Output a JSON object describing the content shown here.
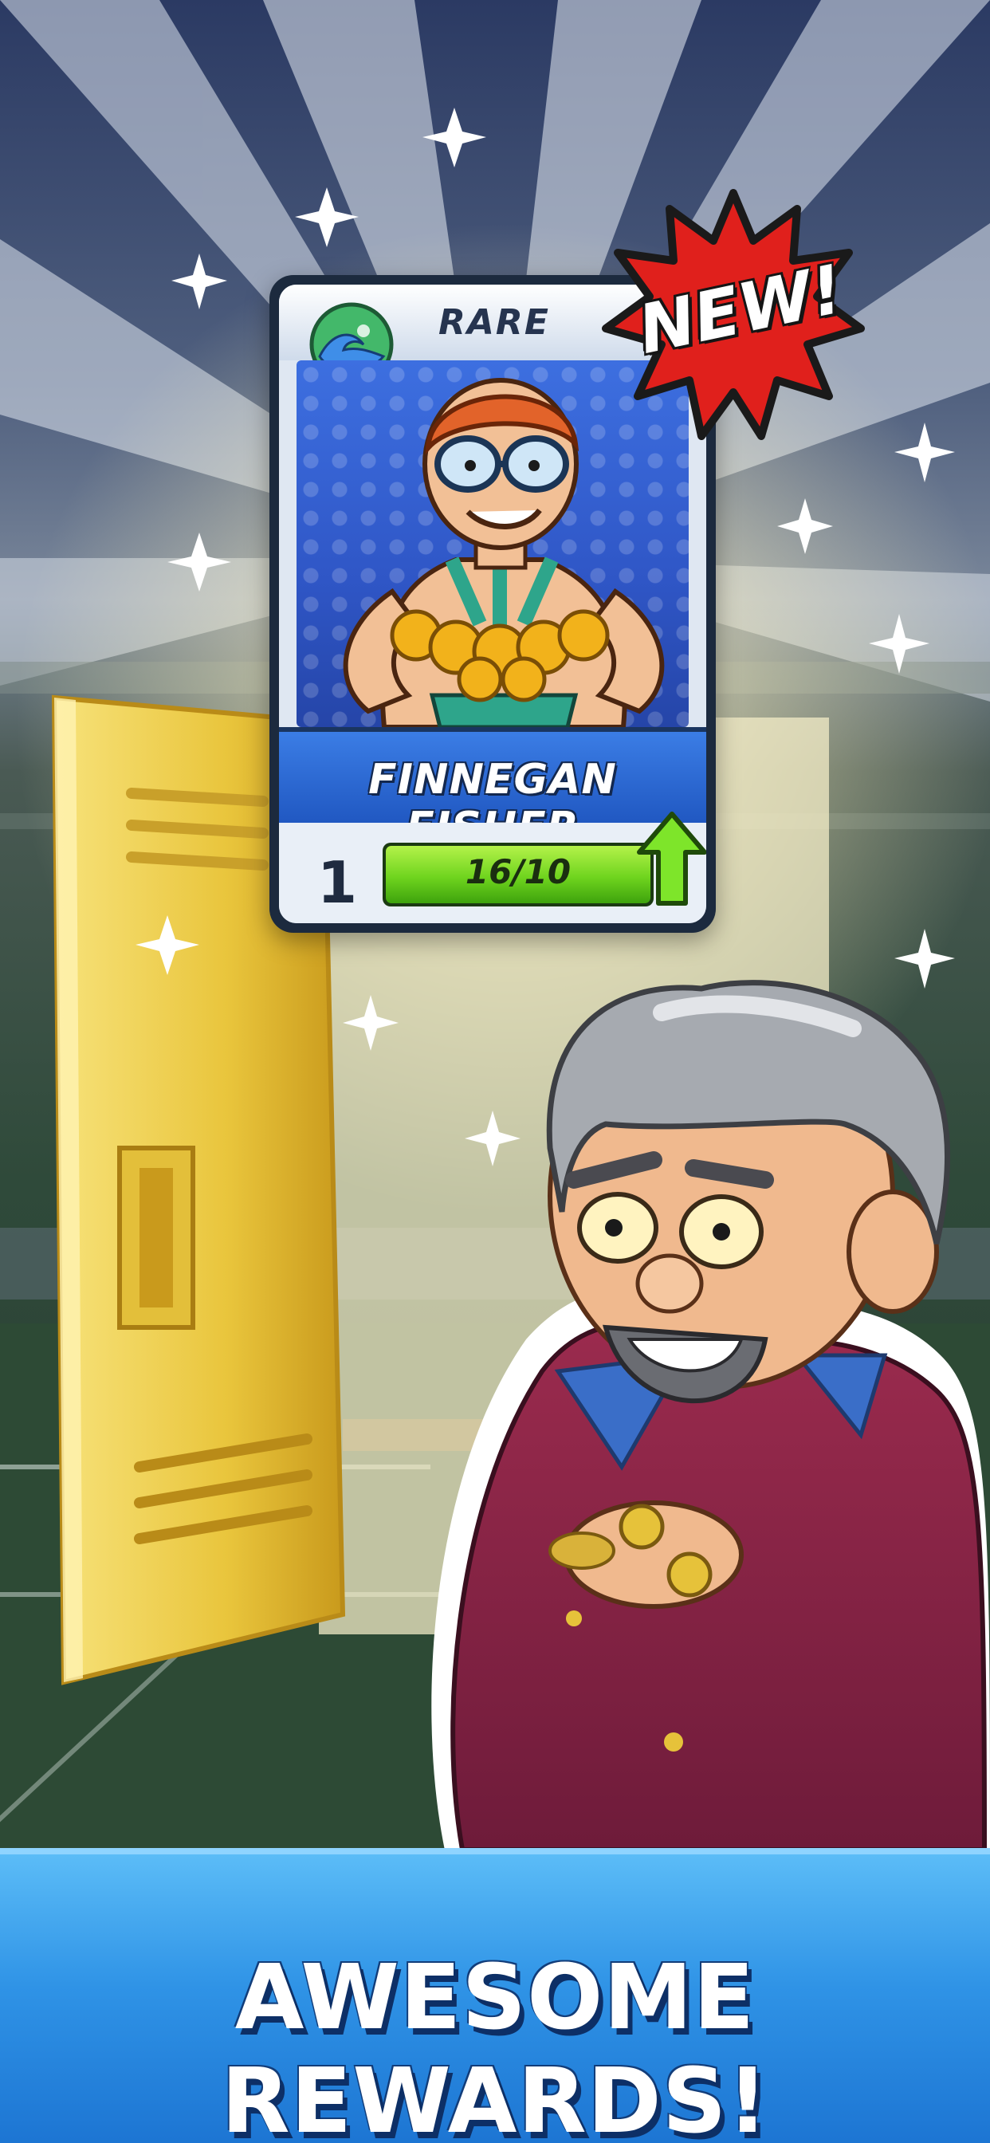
{
  "card": {
    "rarity": "RARE",
    "player_name": "FINNEGAN FISHER",
    "level": "1",
    "progress_text": "16/10",
    "progress_fraction": 1.0,
    "element_icon": "water-wave-icon",
    "upgrade_icon": "upgrade-arrow-icon",
    "badge_text": "NEW!"
  },
  "banner": {
    "title": "AWESOME REWARDS!"
  },
  "colors": {
    "card_blue": "#2f56c6",
    "progress_green": "#6fd41e",
    "badge_red": "#e0201c",
    "banner_blue": "#2f93e6"
  }
}
